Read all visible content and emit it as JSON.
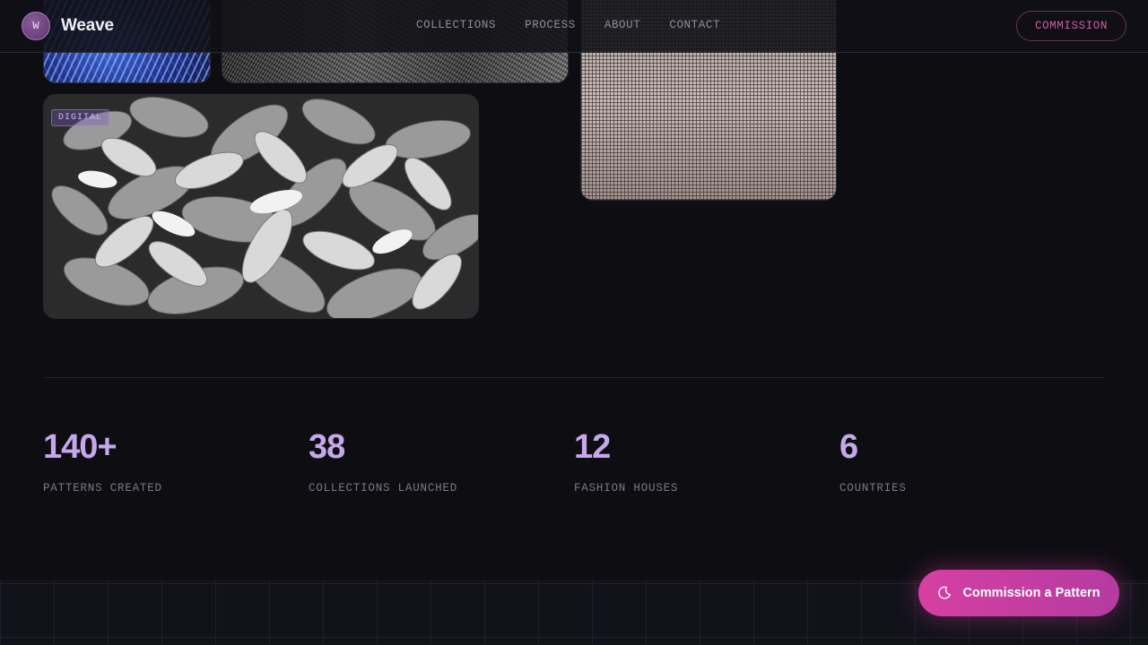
{
  "header": {
    "logo_letter": "W",
    "brand_name": "Weave",
    "nav": [
      {
        "label": "COLLECTIONS"
      },
      {
        "label": "PROCESS"
      },
      {
        "label": "ABOUT"
      },
      {
        "label": "CONTACT"
      }
    ],
    "cta_label": "COMMISSION"
  },
  "gallery": {
    "tiles": [
      {
        "name": "blue-thread-pattern"
      },
      {
        "name": "denim-texture"
      },
      {
        "name": "woven-mesh-texture"
      },
      {
        "name": "succulent-photo",
        "tag": "DIGITAL"
      }
    ]
  },
  "stats": [
    {
      "value": "140+",
      "label": "PATTERNS CREATED"
    },
    {
      "value": "38",
      "label": "COLLECTIONS LAUNCHED"
    },
    {
      "value": "12",
      "label": "FASHION HOUSES"
    },
    {
      "value": "6",
      "label": "COUNTRIES"
    }
  ],
  "fab": {
    "label": "Commission a Pattern",
    "icon": "moon-icon"
  },
  "colors": {
    "background": "#0d0d12",
    "accent_violet": "#c5a8ec",
    "accent_pink": "#d63fa2"
  }
}
